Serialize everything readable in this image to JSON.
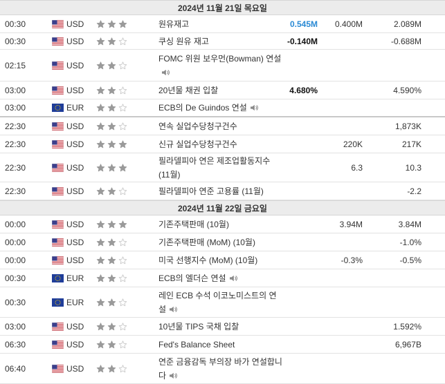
{
  "days": [
    {
      "header": "2024년 11월 21일 목요일",
      "events": [
        {
          "time": "00:30",
          "currency": "USD",
          "flag": "us-flag-icon",
          "stars": 3,
          "event": "원유재고",
          "speaker": false,
          "actual": "0.545M",
          "actual_color": "blue",
          "forecast": "0.400M",
          "previous": "2.089M",
          "h": 26
        },
        {
          "time": "00:30",
          "currency": "USD",
          "flag": "us-flag-icon",
          "stars": 2,
          "event": "쿠싱 원유 재고",
          "speaker": false,
          "actual": "-0.140M",
          "actual_color": "black",
          "forecast": "",
          "previous": "-0.688M",
          "h": 24
        },
        {
          "time": "02:15",
          "currency": "USD",
          "flag": "us-flag-icon",
          "stars": 2,
          "event": "FOMC 위원 보우먼(Bowman) 연설",
          "speaker": true,
          "actual": "",
          "actual_color": "black",
          "forecast": "",
          "previous": "",
          "h": 46
        },
        {
          "time": "03:00",
          "currency": "USD",
          "flag": "us-flag-icon",
          "stars": 2,
          "event": "20년물 채권 입찰",
          "speaker": false,
          "actual": "4.680%",
          "actual_color": "black",
          "forecast": "",
          "previous": "4.590%",
          "h": 26
        },
        {
          "time": "03:00",
          "currency": "EUR",
          "flag": "eu-flag-icon",
          "stars": 2,
          "event": "ECB의 De Guindos 연설",
          "speaker": true,
          "actual": "",
          "actual_color": "black",
          "forecast": "",
          "previous": "",
          "h": 26,
          "thick": true
        },
        {
          "time": "22:30",
          "currency": "USD",
          "flag": "us-flag-icon",
          "stars": 2,
          "event": "연속 실업수당청구건수",
          "speaker": false,
          "actual": "",
          "actual_color": "black",
          "forecast": "",
          "previous": "1,873K",
          "h": 26
        },
        {
          "time": "22:30",
          "currency": "USD",
          "flag": "us-flag-icon",
          "stars": 3,
          "event": "신규 실업수당청구건수",
          "speaker": false,
          "actual": "",
          "actual_color": "black",
          "forecast": "220K",
          "previous": "217K",
          "h": 26
        },
        {
          "time": "22:30",
          "currency": "USD",
          "flag": "us-flag-icon",
          "stars": 3,
          "event": "필라델피아 연은 제조업활동지수 (11월)",
          "speaker": false,
          "actual": "",
          "actual_color": "black",
          "forecast": "6.3",
          "previous": "10.3",
          "h": 42
        },
        {
          "time": "22:30",
          "currency": "USD",
          "flag": "us-flag-icon",
          "stars": 2,
          "event": "필라델피아 연준 고용률 (11월)",
          "speaker": false,
          "actual": "",
          "actual_color": "black",
          "forecast": "",
          "previous": "-2.2",
          "h": 26
        }
      ]
    },
    {
      "header": "2024년 11월 22일 금요일",
      "events": [
        {
          "time": "00:00",
          "currency": "USD",
          "flag": "us-flag-icon",
          "stars": 3,
          "event": "기존주택판매 (10월)",
          "speaker": false,
          "actual": "",
          "actual_color": "black",
          "forecast": "3.94M",
          "previous": "3.84M",
          "h": 26
        },
        {
          "time": "00:00",
          "currency": "USD",
          "flag": "us-flag-icon",
          "stars": 2,
          "event": "기존주택판매 (MoM) (10월)",
          "speaker": false,
          "actual": "",
          "actual_color": "black",
          "forecast": "",
          "previous": "-1.0%",
          "h": 26
        },
        {
          "time": "00:00",
          "currency": "USD",
          "flag": "us-flag-icon",
          "stars": 2,
          "event": "미국 선행지수 (MoM) (10월)",
          "speaker": false,
          "actual": "",
          "actual_color": "black",
          "forecast": "-0.3%",
          "previous": "-0.5%",
          "h": 26
        },
        {
          "time": "00:30",
          "currency": "EUR",
          "flag": "eu-flag-icon",
          "stars": 2,
          "event": "ECB의 엘더슨 연설",
          "speaker": true,
          "actual": "",
          "actual_color": "black",
          "forecast": "",
          "previous": "",
          "h": 26
        },
        {
          "time": "00:30",
          "currency": "EUR",
          "flag": "eu-flag-icon",
          "stars": 2,
          "event": "레인 ECB 수석 이코노미스트의 연설",
          "speaker": true,
          "actual": "",
          "actual_color": "black",
          "forecast": "",
          "previous": "",
          "h": 44
        },
        {
          "time": "03:00",
          "currency": "USD",
          "flag": "us-flag-icon",
          "stars": 2,
          "event": "10년물 TIPS 국채 입찰",
          "speaker": false,
          "actual": "",
          "actual_color": "black",
          "forecast": "",
          "previous": "1.592%",
          "h": 26
        },
        {
          "time": "06:30",
          "currency": "USD",
          "flag": "us-flag-icon",
          "stars": 2,
          "event": "Fed's Balance Sheet",
          "speaker": false,
          "actual": "",
          "actual_color": "black",
          "forecast": "",
          "previous": "6,967B",
          "h": 26
        },
        {
          "time": "06:40",
          "currency": "USD",
          "flag": "us-flag-icon",
          "stars": 2,
          "event": "연준 금융감독 부의장 바가 연설합니다",
          "speaker": true,
          "actual": "",
          "actual_color": "black",
          "forecast": "",
          "previous": "",
          "h": 44
        }
      ]
    }
  ],
  "colors": {
    "star_filled": "#9a9a9a",
    "star_empty": "#c8c8c8",
    "actual_blue": "#2a8ad4",
    "header_bg": "#ececec"
  }
}
